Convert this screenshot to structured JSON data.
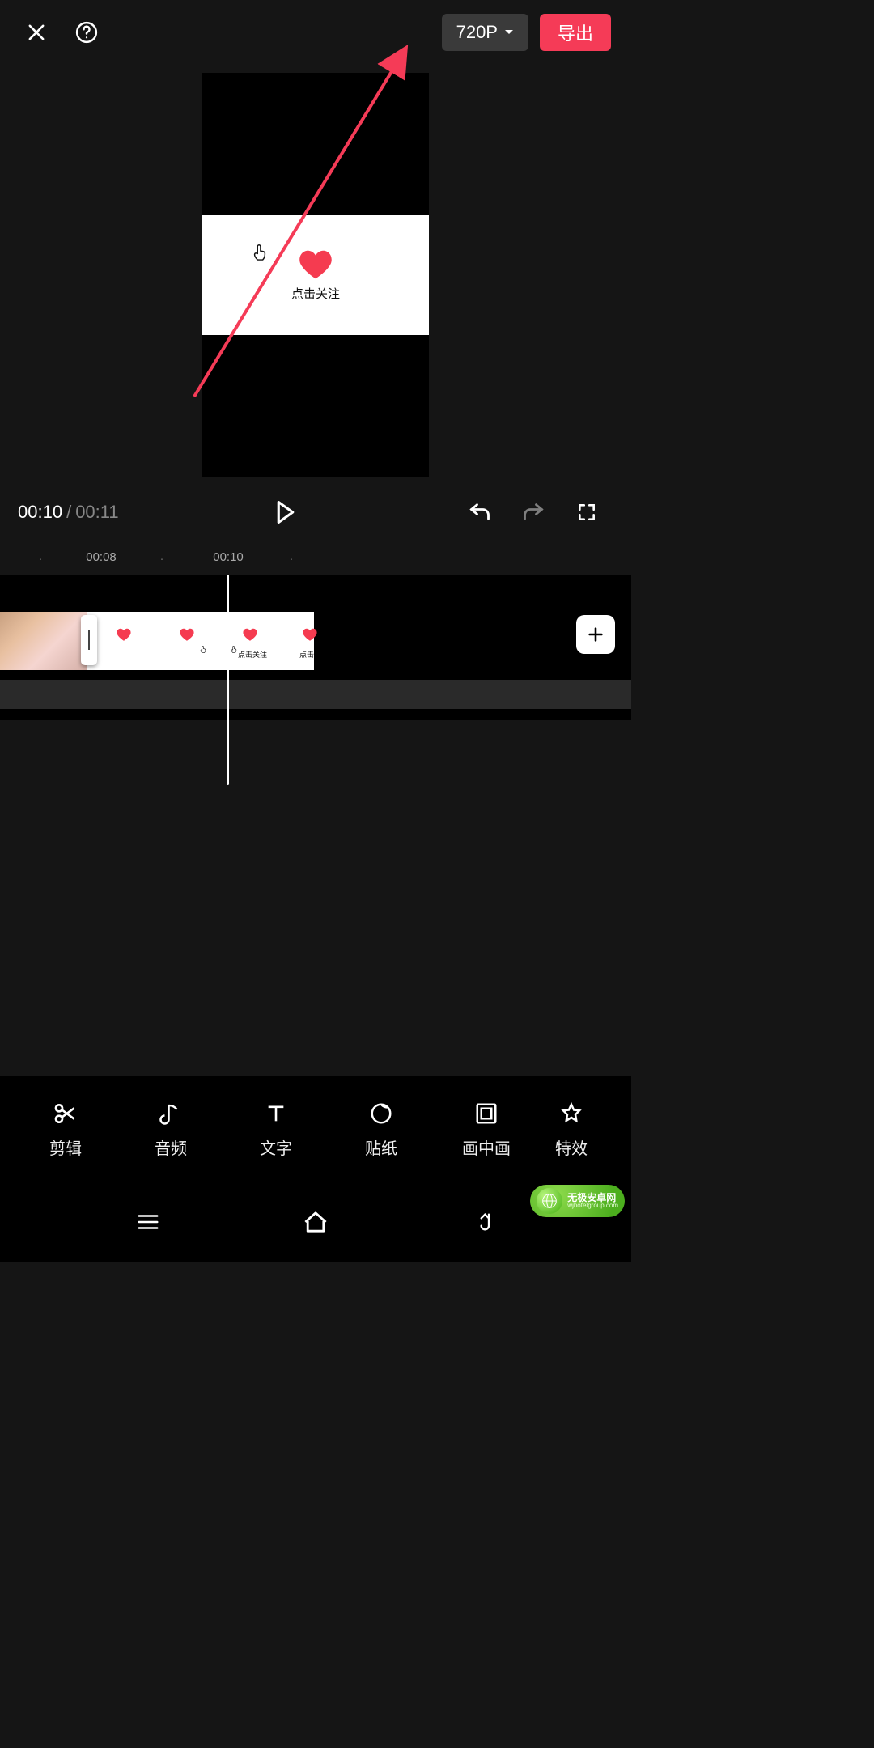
{
  "colors": {
    "accent": "#f53b57"
  },
  "topbar": {
    "resolution_label": "720P",
    "export_label": "导出"
  },
  "preview": {
    "overlay_text": "点击关注"
  },
  "transport": {
    "current_time": "00:10",
    "separator": "/",
    "duration": "00:11"
  },
  "ruler": {
    "marks": [
      {
        "pos": 50,
        "label": "",
        "dot": true
      },
      {
        "pos": 125,
        "label": "00:08",
        "dot": false
      },
      {
        "pos": 200,
        "label": "",
        "dot": true
      },
      {
        "pos": 282,
        "label": "00:10",
        "dot": false
      },
      {
        "pos": 360,
        "label": "",
        "dot": true
      }
    ]
  },
  "timeline": {
    "mini_labels": [
      "点击关注",
      "点击"
    ]
  },
  "toolbar": {
    "items": [
      {
        "id": "cut",
        "label": "剪辑"
      },
      {
        "id": "audio",
        "label": "音频"
      },
      {
        "id": "text",
        "label": "文字"
      },
      {
        "id": "sticker",
        "label": "贴纸"
      },
      {
        "id": "pip",
        "label": "画中画"
      },
      {
        "id": "fx",
        "label": "特效"
      }
    ]
  },
  "watermark": {
    "line1": "无极安卓网",
    "line2": "wjhotelgroup.com"
  }
}
